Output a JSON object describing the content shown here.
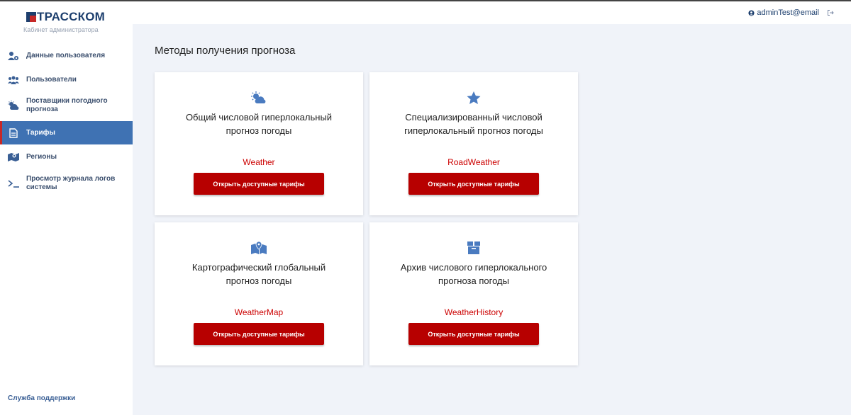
{
  "brand": {
    "name": "ТРАССКОМ",
    "subtitle": "Кабинет администратора"
  },
  "user": {
    "email": "adminTest@email"
  },
  "sidebar": {
    "items": [
      {
        "label": "Данные пользователя",
        "icon": "user-gear-icon"
      },
      {
        "label": "Пользователи",
        "icon": "users-icon"
      },
      {
        "label": "Поставщики погодного прогноза",
        "icon": "cloud-sun-icon"
      },
      {
        "label": "Тарифы",
        "icon": "document-icon",
        "active": true
      },
      {
        "label": "Регионы",
        "icon": "map-icon"
      },
      {
        "label": "Просмотр журнала логов системы",
        "icon": "terminal-icon"
      }
    ],
    "support": "Служба поддержки"
  },
  "main": {
    "title": "Методы получения прогноза",
    "cards": [
      {
        "title": "Общий числовой гиперлокальный прогноз погоды",
        "code": "Weather",
        "button": "Открыть доступные тарифы",
        "icon": "cloud-sun-icon"
      },
      {
        "title": "Специализированный числовой гиперлокальный прогноз погоды",
        "code": "RoadWeather",
        "button": "Открыть доступные тарифы",
        "icon": "star-icon"
      },
      {
        "title": "Картографический глобальный прогноз погоды",
        "code": "WeatherMap",
        "button": "Открыть доступные тарифы",
        "icon": "map-marker-icon"
      },
      {
        "title": "Архив числового гиперлокального прогноза погоды",
        "code": "WeatherHistory",
        "button": "Открыть доступные тарифы",
        "icon": "archive-box-icon"
      }
    ]
  },
  "colors": {
    "primary": "#3f72b3",
    "accent": "#b70000",
    "brand_blue": "#1d3f6e",
    "background": "#f0f3f9"
  }
}
